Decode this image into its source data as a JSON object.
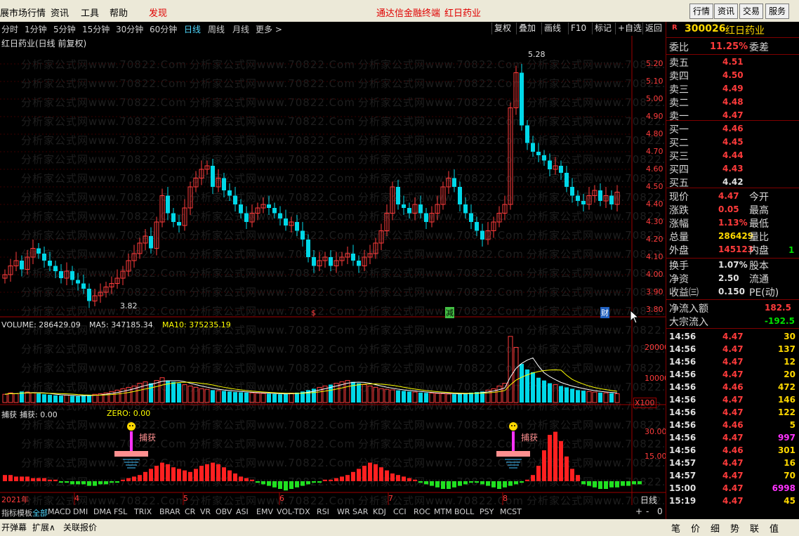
{
  "menu": {
    "items": [
      "展市场行情",
      "资讯",
      "工具",
      "帮助",
      "发现"
    ],
    "center": [
      "通达信金融终端",
      "红日药业"
    ],
    "right_buttons": [
      "行情",
      "资讯",
      "交易",
      "服务"
    ]
  },
  "periods": [
    "分时",
    "1分钟",
    "5分钟",
    "15分钟",
    "30分钟",
    "60分钟",
    "日线",
    "周线",
    "月线",
    "更多 >"
  ],
  "tools": [
    "复权",
    "叠加",
    "画线",
    "F10",
    "标记",
    "+自选",
    "返回"
  ],
  "chart": {
    "title": "红日药业(日线 前复权)",
    "high_label": "5.28",
    "low_label": "3.82",
    "price_axis": [
      "5.20",
      "5.10",
      "5.00",
      "4.90",
      "4.80",
      "4.70",
      "4.60",
      "4.50",
      "4.40",
      "4.30",
      "4.20",
      "4.10",
      "4.00",
      "3.90",
      "3.80"
    ],
    "markers": [
      "$",
      "减",
      "财"
    ],
    "vol_header": {
      "volume": "VOLUME: 286429.09",
      "ma5": "MA5: 347185.34",
      "ma10": "MA10: 375235.19"
    },
    "vol_axis": [
      "20000",
      "10000"
    ],
    "vol_unit": "X100",
    "ind_header": {
      "name": "捕获",
      "value": "捕获: 0.00",
      "zero": "ZERO: 0.00"
    },
    "ind_axis": [
      "30.00",
      "15.00"
    ],
    "capture_label": "捕获",
    "x_labels": [
      "2021年",
      "4",
      "5",
      "6",
      "7",
      "8"
    ],
    "period_label": "日线",
    "zoom": [
      "+",
      "-",
      "0"
    ],
    "watermark": "分析家公式网www.70822.Com"
  },
  "chart_data": {
    "type": "candlestick",
    "ylim": [
      3.78,
      5.32
    ],
    "closes": [
      4.0,
      4.05,
      4.08,
      4.03,
      4.1,
      4.15,
      4.12,
      4.08,
      4.05,
      4.02,
      3.98,
      4.02,
      3.97,
      3.95,
      3.92,
      3.85,
      3.88,
      3.9,
      3.93,
      3.95,
      3.98,
      4.02,
      4.08,
      4.12,
      4.18,
      4.22,
      4.15,
      4.3,
      4.45,
      4.35,
      4.3,
      4.28,
      4.38,
      4.5,
      4.55,
      4.6,
      4.62,
      4.5,
      4.55,
      4.48,
      4.45,
      4.4,
      4.35,
      4.3,
      4.35,
      4.38,
      4.4,
      4.38,
      4.35,
      4.32,
      4.28,
      4.3,
      4.25,
      4.2,
      4.1,
      4.05,
      4.08,
      4.1,
      4.05,
      4.08,
      4.1,
      4.12,
      4.08,
      4.05,
      4.1,
      4.12,
      4.18,
      4.25,
      4.35,
      4.5,
      4.4,
      4.38,
      4.35,
      4.4,
      4.35,
      4.3,
      4.35,
      4.4,
      4.5,
      4.55,
      4.5,
      4.4,
      4.35,
      4.3,
      4.25,
      4.2,
      4.25,
      4.3,
      4.35,
      4.4,
      4.95,
      5.15,
      4.85,
      4.75,
      4.7,
      4.68,
      4.65,
      4.6,
      4.62,
      4.58,
      4.5,
      4.45,
      4.42,
      4.4,
      4.45,
      4.48,
      4.42,
      4.45,
      4.4,
      4.47
    ],
    "volumes": [
      3000,
      3500,
      3200,
      4000,
      3800,
      3500,
      3300,
      3000,
      2800,
      2600,
      2500,
      2700,
      2400,
      2300,
      2600,
      2800,
      3000,
      3200,
      3500,
      4000,
      4500,
      5000,
      5500,
      6000,
      7000,
      7500,
      7000,
      8000,
      9000,
      8000,
      7500,
      7000,
      6500,
      6000,
      5500,
      5000,
      4800,
      4500,
      4300,
      4200,
      4000,
      3800,
      3700,
      3600,
      3500,
      3400,
      3300,
      3200,
      3100,
      3000,
      3200,
      3400,
      3600,
      4000,
      4500,
      5000,
      5500,
      6000,
      6500,
      7000,
      7500,
      8000,
      7500,
      7000,
      6500,
      6000,
      5500,
      5000,
      4800,
      4600,
      4400,
      4200,
      4000,
      3800,
      3600,
      3500,
      3400,
      3300,
      3200,
      3100,
      3000,
      3200,
      3400,
      3600,
      3800,
      4000,
      4500,
      5000,
      6000,
      7000,
      24000,
      20000,
      14000,
      12000,
      11000,
      9000,
      8000,
      7000,
      6500,
      6000,
      5500,
      5000,
      4500,
      4300,
      4000,
      3800,
      3600,
      3500,
      3400,
      3200
    ],
    "indicator": [
      4,
      4,
      3,
      3,
      3,
      2,
      2,
      2,
      1,
      1,
      -1,
      -1,
      -2,
      -2,
      -2,
      -3,
      -3,
      -2,
      -2,
      -1,
      -1,
      1,
      2,
      3,
      4,
      6,
      8,
      10,
      12,
      11,
      9,
      8,
      7,
      6,
      8,
      10,
      11,
      12,
      11,
      9,
      7,
      5,
      3,
      2,
      1,
      -1,
      -2,
      -3,
      -4,
      -5,
      -6,
      -5,
      -4,
      -3,
      -2,
      -1,
      -1,
      1,
      1,
      2,
      3,
      4,
      6,
      8,
      10,
      12,
      11,
      9,
      7,
      5,
      4,
      3,
      2,
      1,
      -1,
      -2,
      -3,
      -4,
      -5,
      -5,
      -4,
      -3,
      -2,
      -1,
      -1,
      -2,
      -3,
      -4,
      -5,
      -4,
      -3,
      -2,
      -1,
      1,
      4,
      10,
      20,
      30,
      32,
      26,
      16,
      8,
      4,
      -2,
      -3,
      -4,
      -5,
      -5,
      -4,
      -4,
      -3,
      -3,
      -2,
      -2
    ]
  },
  "quote": {
    "code": "300026",
    "name": "红日药业",
    "weibi_label": "委比",
    "weibi": "11.25%",
    "weicha_label": "委差",
    "asks": [
      {
        "label": "卖五",
        "price": "4.51"
      },
      {
        "label": "卖四",
        "price": "4.50"
      },
      {
        "label": "卖三",
        "price": "4.49"
      },
      {
        "label": "卖二",
        "price": "4.48"
      },
      {
        "label": "卖一",
        "price": "4.47"
      }
    ],
    "bids": [
      {
        "label": "买一",
        "price": "4.46"
      },
      {
        "label": "买二",
        "price": "4.45"
      },
      {
        "label": "买三",
        "price": "4.44"
      },
      {
        "label": "买四",
        "price": "4.43"
      },
      {
        "label": "买五",
        "price": "4.42"
      }
    ],
    "stats": [
      {
        "l": "现价",
        "v": "4.47",
        "r": "今开",
        "c": "#ff3b3b"
      },
      {
        "l": "涨跌",
        "v": "0.05",
        "r": "最高",
        "c": "#ff3b3b"
      },
      {
        "l": "涨幅",
        "v": "1.13%",
        "r": "最低",
        "c": "#ff3b3b"
      },
      {
        "l": "总量",
        "v": "286429",
        "r": "量比",
        "c": "#ffd800"
      },
      {
        "l": "外盘",
        "v": "145123",
        "r": "内盘",
        "c": "#ff3b3b"
      }
    ],
    "stats2": [
      {
        "l": "换手",
        "v": "1.07%",
        "r": "股本"
      },
      {
        "l": "净资",
        "v": "2.50",
        "r": "流通"
      },
      {
        "l": "收益㈢",
        "v": "0.150",
        "r": "PE(动)"
      }
    ],
    "flow": [
      {
        "l": "净流入额",
        "v": "182.5",
        "c": "#ff3b3b"
      },
      {
        "l": "大宗流入",
        "v": "-192.5",
        "c": "#00e000"
      }
    ],
    "neipan_tail": "1",
    "ticks": [
      {
        "t": "14:56",
        "p": "4.47",
        "v": "30",
        "c": "#ffd800"
      },
      {
        "t": "14:56",
        "p": "4.47",
        "v": "137",
        "c": "#ffd800"
      },
      {
        "t": "14:56",
        "p": "4.47",
        "v": "12",
        "c": "#ffd800"
      },
      {
        "t": "14:56",
        "p": "4.47",
        "v": "20",
        "c": "#ffd800"
      },
      {
        "t": "14:56",
        "p": "4.46",
        "v": "472",
        "c": "#ffd800"
      },
      {
        "t": "14:56",
        "p": "4.47",
        "v": "146",
        "c": "#ffd800"
      },
      {
        "t": "14:56",
        "p": "4.47",
        "v": "122",
        "c": "#ffd800"
      },
      {
        "t": "14:56",
        "p": "4.46",
        "v": "5",
        "c": "#ffd800"
      },
      {
        "t": "14:56",
        "p": "4.47",
        "v": "997",
        "c": "#ff33ff"
      },
      {
        "t": "14:56",
        "p": "4.46",
        "v": "301",
        "c": "#ffd800"
      },
      {
        "t": "14:57",
        "p": "4.47",
        "v": "16",
        "c": "#ffd800"
      },
      {
        "t": "14:57",
        "p": "4.47",
        "v": "70",
        "c": "#ffd800"
      },
      {
        "t": "15:00",
        "p": "4.47",
        "v": "6998",
        "c": "#ff33ff"
      },
      {
        "t": "15:19",
        "p": "4.47",
        "v": "45",
        "c": "#ffd800"
      }
    ]
  },
  "indicator_tabs": [
    "指标",
    "模板",
    "全部",
    "MACD",
    "DMI",
    "DMA",
    "FSL",
    "TRIX",
    "BRAR",
    "CR",
    "VR",
    "OBV",
    "ASI",
    "EMV",
    "VOL-TDX",
    "RSI",
    "WR",
    "SAR",
    "KDJ",
    "CCI",
    "ROC",
    "MTM",
    "BOLL",
    "PSY",
    "MCST"
  ],
  "bottom": [
    "开弹幕",
    "扩展∧",
    "关联报价"
  ],
  "right_tabs": [
    "笔",
    "价",
    "细",
    "势",
    "联",
    "值"
  ]
}
